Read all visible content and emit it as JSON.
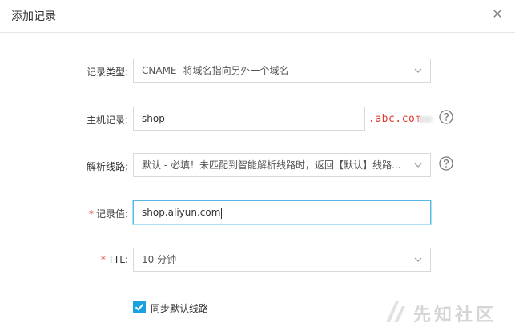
{
  "dialog": {
    "title": "添加记录",
    "close_icon": "close-icon"
  },
  "form": {
    "record_type": {
      "label": "记录类型:",
      "value": "CNAME- 将域名指向另外一个域名",
      "required": false
    },
    "host_record": {
      "label": "主机记录:",
      "value": "shop",
      "domain_suffix": ".abc.com",
      "help_icon": "question-circle-icon",
      "required": false
    },
    "resolution_line": {
      "label": "解析线路:",
      "value": "默认 - 必填！未匹配到智能解析线路时，返回【默认】线路...",
      "help_icon": "question-circle-icon",
      "required": false
    },
    "record_value": {
      "label": "记录值:",
      "value": "shop.aliyun.com",
      "required": true,
      "required_mark": "*"
    },
    "ttl": {
      "label": "TTL:",
      "value": "10 分钟",
      "required": true,
      "required_mark": "*"
    },
    "sync_default": {
      "label": "同步默认线路",
      "checked": true
    }
  },
  "watermark": {
    "text": "先知社区"
  },
  "colors": {
    "accent": "#1aa1e0",
    "focus_border": "#59b7e6",
    "required": "#e5483b",
    "suffix_text": "#e13a2e"
  }
}
